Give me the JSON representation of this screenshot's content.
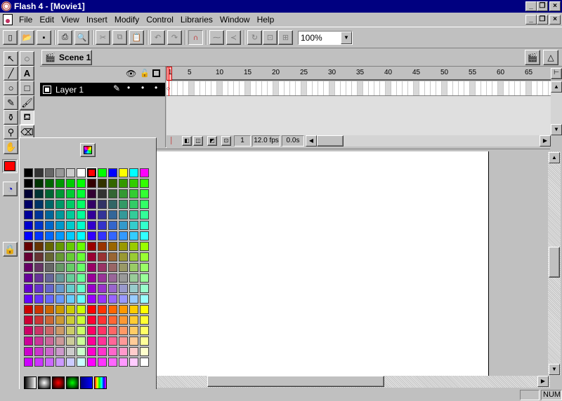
{
  "window": {
    "title": "Flash 4 - [Movie1]",
    "icon": "flash-app-icon",
    "caption_buttons": [
      "_",
      "❐",
      "×"
    ]
  },
  "menubar": {
    "items": [
      "File",
      "Edit",
      "View",
      "Insert",
      "Modify",
      "Control",
      "Libraries",
      "Window",
      "Help"
    ]
  },
  "toolbar": {
    "zoom": "100%"
  },
  "scene": {
    "label": "Scene 1"
  },
  "timeline": {
    "layer_name": "Layer 1",
    "ruler_ticks": [
      "1",
      "5",
      "10",
      "15",
      "20",
      "25",
      "30",
      "35",
      "40",
      "45",
      "50",
      "55",
      "60",
      "65"
    ],
    "current_frame": "1",
    "fps": "12.0 fps",
    "elapsed": "0.0s"
  },
  "colors": {
    "selected_fill": "#ff0000",
    "title_bar": "#000080"
  },
  "status": {
    "num": "NUM"
  }
}
